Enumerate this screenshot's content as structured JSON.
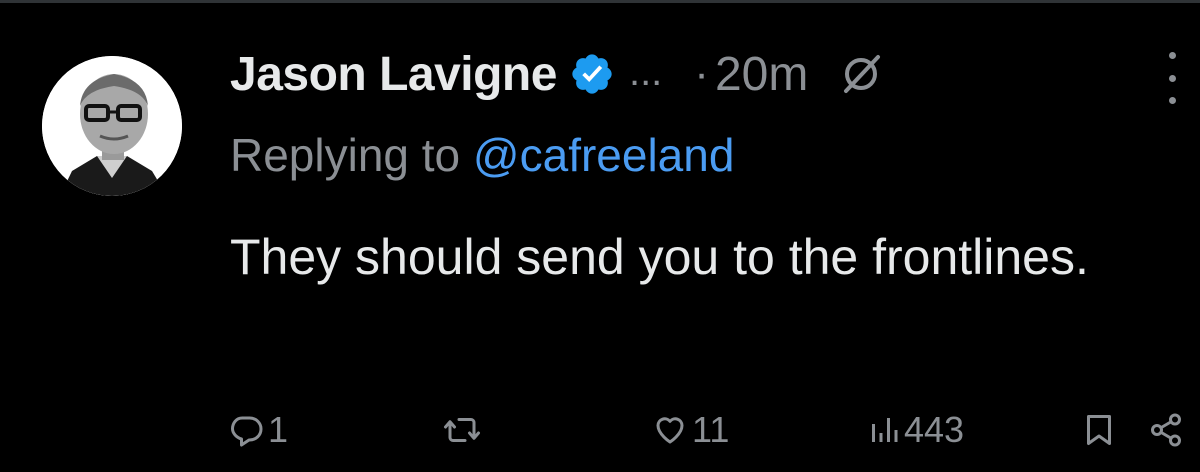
{
  "tweet": {
    "author_name": "Jason Lavigne",
    "truncation": "...",
    "separator": "·",
    "time": "20m",
    "replying_prefix": "Replying to ",
    "replying_handle": "@cafreeland",
    "text": "They should send you to the frontlines."
  },
  "actions": {
    "reply_count": "1",
    "repost_count": "",
    "like_count": "11",
    "views_count": "443"
  },
  "icons": {
    "verified": "verified-badge-icon",
    "grok": "grok-icon",
    "more": "more-options-icon",
    "reply": "reply-icon",
    "repost": "repost-icon",
    "like": "heart-icon",
    "views": "views-icon",
    "bookmark": "bookmark-icon",
    "share": "share-icon"
  },
  "colors": {
    "background": "#000000",
    "text": "#e7e9ea",
    "muted": "#8b8f94",
    "link": "#4b9cf2",
    "verified": "#1d9bf0"
  }
}
